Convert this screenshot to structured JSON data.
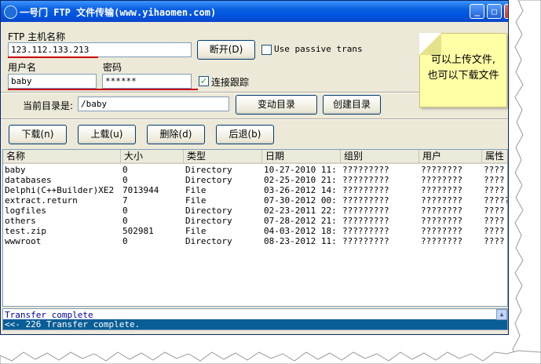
{
  "window": {
    "title": "一号门 FTP 文件传输(www.yihaomen.com)"
  },
  "connection": {
    "host_label": "FTP 主机名称",
    "host_value": "123.112.133.213",
    "disconnect_label": "断开(D)",
    "passive_label": "Use passive trans",
    "passive_checked": false,
    "user_label": "用户名",
    "user_value": "baby",
    "password_label": "密码",
    "password_value": "******",
    "trace_label": "连接跟踪",
    "trace_checked": true,
    "current_dir_label": "当前目录是:",
    "current_dir_value": "/baby",
    "change_dir_label": "变动目录",
    "create_dir_label": "创建目录"
  },
  "note": {
    "text": "可以上传文件, 也可以下载文件"
  },
  "toolbar": {
    "download_label": "下载(n)",
    "upload_label": "上载(u)",
    "delete_label": "删除(d)",
    "back_label": "后退(b)"
  },
  "table": {
    "columns": [
      "名称",
      "大小",
      "类型",
      "日期",
      "组别",
      "用户",
      "属性"
    ],
    "rows": [
      [
        "baby",
        "0",
        "Directory",
        "10-27-2010 11:",
        "?????????",
        "????????",
        "????"
      ],
      [
        "databases",
        "0",
        "Directory",
        "02-25-2010 21:",
        "?????????",
        "????????",
        "????"
      ],
      [
        "Delphi(C++Builder)XE2",
        "7013944",
        "File",
        "03-26-2012 14:",
        "?????????",
        "????????",
        "????"
      ],
      [
        "extract.return",
        "7",
        "File",
        "07-30-2012 00:",
        "?????????",
        "????????",
        "?????"
      ],
      [
        "logfiles",
        "0",
        "Directory",
        "02-23-2011 22:",
        "?????????",
        "????????",
        "????"
      ],
      [
        "others",
        "0",
        "Directory",
        "07-28-2012 21:",
        "?????????",
        "????????",
        "????"
      ],
      [
        "test.zip",
        "502981",
        "File",
        "04-03-2012 18:",
        "?????????",
        "????????",
        "????"
      ],
      [
        "wwwroot",
        "0",
        "Directory",
        "08-23-2012 11:",
        "?????????",
        "????????",
        "????"
      ]
    ]
  },
  "log": {
    "line1": "Transfer complete",
    "line2": "<<- 226 Transfer complete."
  },
  "colors": {
    "titlebar": "#0a5fe0",
    "window_bg": "#ece9d8",
    "annotation_red": "#c80000",
    "note_bg": "#ffffa5",
    "log_highlight": "#0a5e96"
  }
}
